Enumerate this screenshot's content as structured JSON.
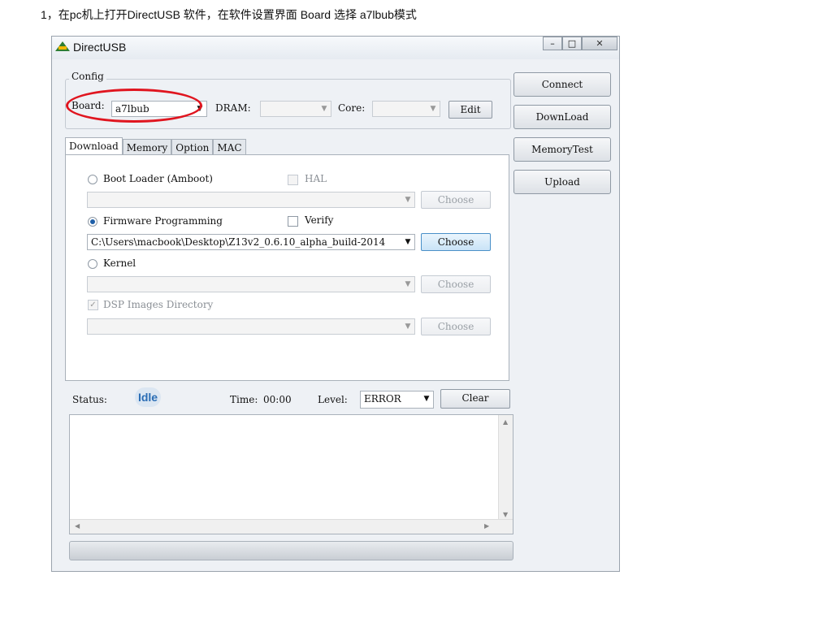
{
  "caption": "1，在pc机上打开DirectUSB 软件，在软件设置界面 Board 选择 a7lbub模式",
  "window": {
    "title": "DirectUSB",
    "controls": [
      "–",
      "□",
      "✕"
    ]
  },
  "config": {
    "legend": "Config",
    "board_label": "Board:",
    "board_value": "a7lbub",
    "dram_label": "DRAM:",
    "dram_value": "",
    "core_label": "Core:",
    "core_value": "",
    "edit_button": "Edit"
  },
  "side_buttons": [
    "Connect",
    "DownLoad",
    "MemoryTest",
    "Upload"
  ],
  "tabs": [
    "Download",
    "Memory",
    "Option",
    "MAC"
  ],
  "download": {
    "bootloader_label": "Boot Loader (Amboot)",
    "hal_label": "HAL",
    "bootloader_path": "",
    "firmware_label": "Firmware Programming",
    "verify_label": "Verify",
    "firmware_path": "C:\\Users\\macbook\\Desktop\\Z13v2_0.6.10_alpha_build-2014",
    "kernel_label": "Kernel",
    "kernel_path": "",
    "dsp_label": "DSP Images Directory",
    "dsp_path": "",
    "choose_label": "Choose"
  },
  "status": {
    "status_label": "Status:",
    "status_value": "Idle",
    "time_label": "Time:",
    "time_value": "00:00",
    "level_label": "Level:",
    "level_value": "ERROR",
    "clear_button": "Clear"
  },
  "progress": 0,
  "annotation_color": "#e0151f"
}
